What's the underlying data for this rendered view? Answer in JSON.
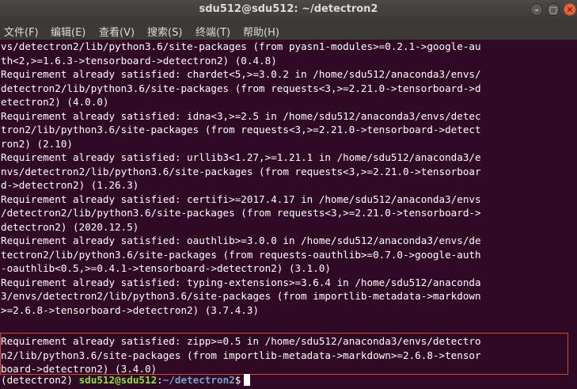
{
  "window": {
    "title": "sdu512@sdu512: ~/detectron2",
    "minimize_glyph": "–",
    "maximize_glyph": "□",
    "close_glyph": "✕"
  },
  "menu": {
    "items": [
      "文件(F)",
      "编辑(E)",
      "查看(V)",
      "搜索(S)",
      "终端(T)",
      "帮助(H)"
    ]
  },
  "terminal": {
    "lines": [
      "vs/detectron2/lib/python3.6/site-packages (from pyasn1-modules>=0.2.1->google-au",
      "th<2,>=1.6.3->tensorboard->detectron2) (0.4.8)",
      "Requirement already satisfied: chardet<5,>=3.0.2 in /home/sdu512/anaconda3/envs/",
      "detectron2/lib/python3.6/site-packages (from requests<3,>=2.21.0->tensorboard->d",
      "etectron2) (4.0.0)",
      "Requirement already satisfied: idna<3,>=2.5 in /home/sdu512/anaconda3/envs/detec",
      "tron2/lib/python3.6/site-packages (from requests<3,>=2.21.0->tensorboard->detect",
      "ron2) (2.10)",
      "Requirement already satisfied: urllib3<1.27,>=1.21.1 in /home/sdu512/anaconda3/e",
      "nvs/detectron2/lib/python3.6/site-packages (from requests<3,>=2.21.0->tensorboar",
      "d->detectron2) (1.26.3)",
      "Requirement already satisfied: certifi>=2017.4.17 in /home/sdu512/anaconda3/envs",
      "/detectron2/lib/python3.6/site-packages (from requests<3,>=2.21.0->tensorboard->",
      "detectron2) (2020.12.5)",
      "Requirement already satisfied: oauthlib>=3.0.0 in /home/sdu512/anaconda3/envs/de",
      "tectron2/lib/python3.6/site-packages (from requests-oauthlib>=0.7.0->google-auth",
      "-oauthlib<0.5,>=0.4.1->tensorboard->detectron2) (3.1.0)",
      "Requirement already satisfied: typing-extensions>=3.6.4 in /home/sdu512/anaconda",
      "3/envs/detectron2/lib/python3.6/site-packages (from importlib-metadata->markdown",
      ">=2.6.8->tensorboard->detectron2) (3.7.4.3)",
      "Requirement already satisfied: zipp>=0.5 in /home/sdu512/anaconda3/envs/detectro",
      "n2/lib/python3.6/site-packages (from importlib-metadata->markdown>=2.6.8->tensor",
      "board->detectron2) (3.4.0)"
    ],
    "prompt": {
      "env": "(detectron2) ",
      "user_host": "sdu512@sdu512",
      "separator": ":",
      "path": "~/detectron2",
      "symbol": "$"
    }
  },
  "colors": {
    "terminal_bg": "#300a24",
    "text": "#ffffff",
    "prompt_user": "#8ae234",
    "prompt_path": "#729fcf",
    "highlight_box": "#d0463c"
  }
}
